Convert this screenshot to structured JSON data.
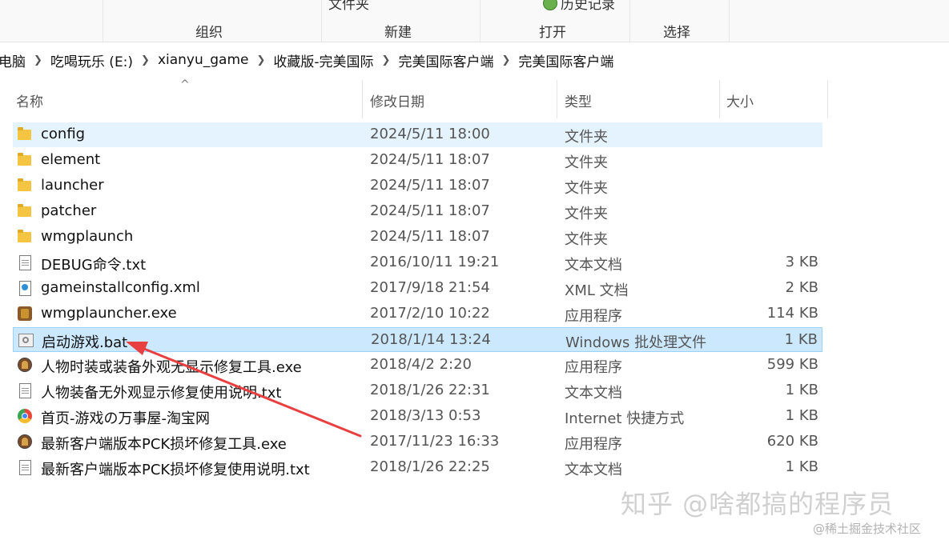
{
  "ribbon": {
    "top_labels": [
      "文件夹",
      "历史记录"
    ],
    "groups": [
      "组织",
      "新建",
      "打开",
      "选择"
    ]
  },
  "address": {
    "crumbs": [
      "电脑",
      "吃喝玩乐 (E:)",
      "xianyu_game",
      "收藏版-完美国际",
      "完美国际客户端",
      "完美国际客户端"
    ]
  },
  "columns": {
    "name": "名称",
    "date": "修改日期",
    "type": "类型",
    "size": "大小"
  },
  "files": [
    {
      "name": "config",
      "date": "2024/5/11 18:00",
      "type": "文件夹",
      "size": "",
      "icon": "folder-icon"
    },
    {
      "name": "element",
      "date": "2024/5/11 18:07",
      "type": "文件夹",
      "size": "",
      "icon": "folder-icon"
    },
    {
      "name": "launcher",
      "date": "2024/5/11 18:07",
      "type": "文件夹",
      "size": "",
      "icon": "folder-icon"
    },
    {
      "name": "patcher",
      "date": "2024/5/11 18:07",
      "type": "文件夹",
      "size": "",
      "icon": "folder-icon"
    },
    {
      "name": "wmgplaunch",
      "date": "2024/5/11 18:07",
      "type": "文件夹",
      "size": "",
      "icon": "folder-icon"
    },
    {
      "name": "DEBUG命令.txt",
      "date": "2016/10/11 19:21",
      "type": "文本文档",
      "size": "3 KB",
      "icon": "text-file-icon"
    },
    {
      "name": "gameinstallconfig.xml",
      "date": "2017/9/18 21:54",
      "type": "XML 文档",
      "size": "2 KB",
      "icon": "xml-file-icon"
    },
    {
      "name": "wmgplauncher.exe",
      "date": "2017/2/10 10:22",
      "type": "应用程序",
      "size": "114 KB",
      "icon": "exe-icon"
    },
    {
      "name": "启动游戏.bat",
      "date": "2018/1/14 13:24",
      "type": "Windows 批处理文件",
      "size": "1 KB",
      "icon": "batch-file-icon"
    },
    {
      "name": "人物时装或装备外观无显示修复工具.exe",
      "date": "2018/4/2 2:20",
      "type": "应用程序",
      "size": "599 KB",
      "icon": "repair-tool-icon"
    },
    {
      "name": "人物装备无外观显示修复使用说明.txt",
      "date": "2018/1/26 22:31",
      "type": "文本文档",
      "size": "1 KB",
      "icon": "text-file-icon"
    },
    {
      "name": "首页-游戏の万事屋-淘宝网",
      "date": "2018/3/13 0:53",
      "type": "Internet 快捷方式",
      "size": "1 KB",
      "icon": "web-shortcut-icon"
    },
    {
      "name": "最新客户端版本PCK损坏修复工具.exe",
      "date": "2017/11/23 16:33",
      "type": "应用程序",
      "size": "620 KB",
      "icon": "repair-tool-icon"
    },
    {
      "name": "最新客户端版本PCK损坏修复使用说明.txt",
      "date": "2018/1/26 22:25",
      "type": "文本文档",
      "size": "1 KB",
      "icon": "text-file-icon"
    }
  ],
  "selection": {
    "selected_file": "启动游戏.bat",
    "hovered_file": "config"
  },
  "colors": {
    "selected_bg": "#cce8ff",
    "hover_bg": "#e5f3ff",
    "arrow": "#e84040"
  },
  "watermark": {
    "main": "知乎 @啥都搞的程序员",
    "sub": "@稀土掘金技术社区"
  }
}
